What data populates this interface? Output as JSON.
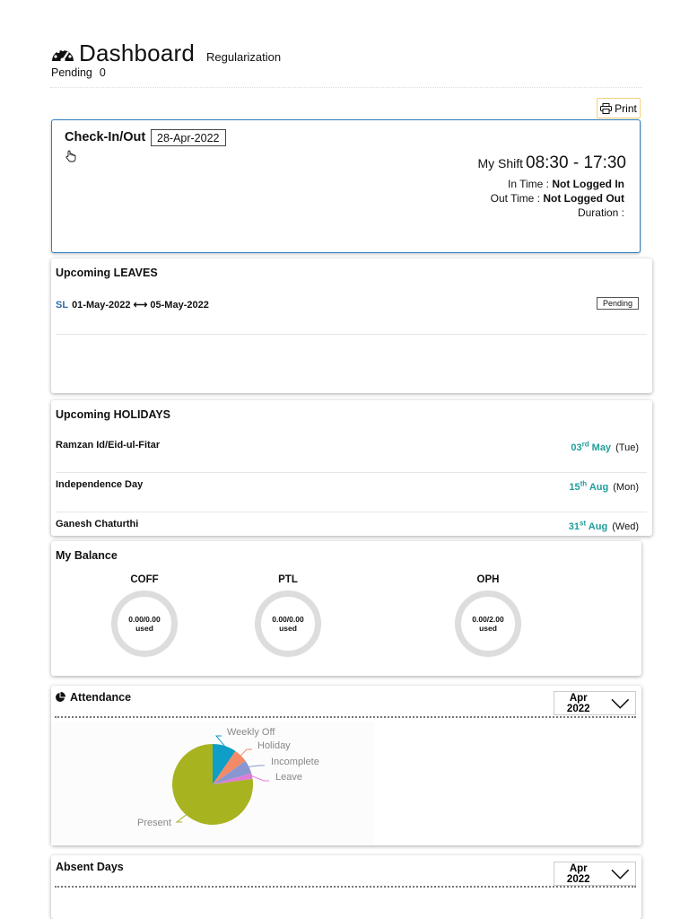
{
  "header": {
    "title": "Dashboard",
    "subtitle": "Regularization",
    "pending_label": "Pending",
    "pending_count": "0",
    "print_label": "Print"
  },
  "checkin": {
    "title": "Check-In/Out",
    "date": "28-Apr-2022",
    "shift_label": "My Shift",
    "shift_time": "08:30 - 17:30",
    "in_label": "In Time :",
    "in_value": "Not Logged In",
    "out_label": "Out Time :",
    "out_value": "Not Logged Out",
    "duration_label": "Duration :"
  },
  "leaves": {
    "title": "Upcoming LEAVES",
    "items": [
      {
        "type": "SL",
        "from": "01-May-2022",
        "arrow": "⟷",
        "to": "05-May-2022",
        "status": "Pending"
      }
    ]
  },
  "holidays": {
    "title": "Upcoming HOLIDAYS",
    "items": [
      {
        "name": "Ramzan Id/Eid-ul-Fitar",
        "day": "03",
        "suffix": "rd",
        "month": "May",
        "dow": "(Tue)"
      },
      {
        "name": "Independence Day",
        "day": "15",
        "suffix": "th",
        "month": "Aug",
        "dow": "(Mon)"
      },
      {
        "name": "Ganesh Chaturthi",
        "day": "31",
        "suffix": "st",
        "month": "Aug",
        "dow": "(Wed)"
      }
    ]
  },
  "balance": {
    "title": "My Balance",
    "items": [
      {
        "name": "COFF",
        "value": "0.00/0.00",
        "unit": "used"
      },
      {
        "name": "PTL",
        "value": "0.00/0.00",
        "unit": "used"
      },
      {
        "name": "OPH",
        "value": "0.00/2.00",
        "unit": "used"
      }
    ]
  },
  "attendance": {
    "title": "Attendance",
    "month": "Apr 2022"
  },
  "chart_data": {
    "type": "pie",
    "categories": [
      "Present",
      "Weekly Off",
      "Holiday",
      "Incomplete",
      "Leave"
    ],
    "values": [
      21,
      2.6,
      1.5,
      1.5,
      0.6
    ],
    "colors": [
      "#a8b320",
      "#0e9ec6",
      "#f28a67",
      "#8a96cf",
      "#e07bd6"
    ]
  },
  "absent": {
    "title": "Absent Days",
    "month": "Apr 2022"
  }
}
